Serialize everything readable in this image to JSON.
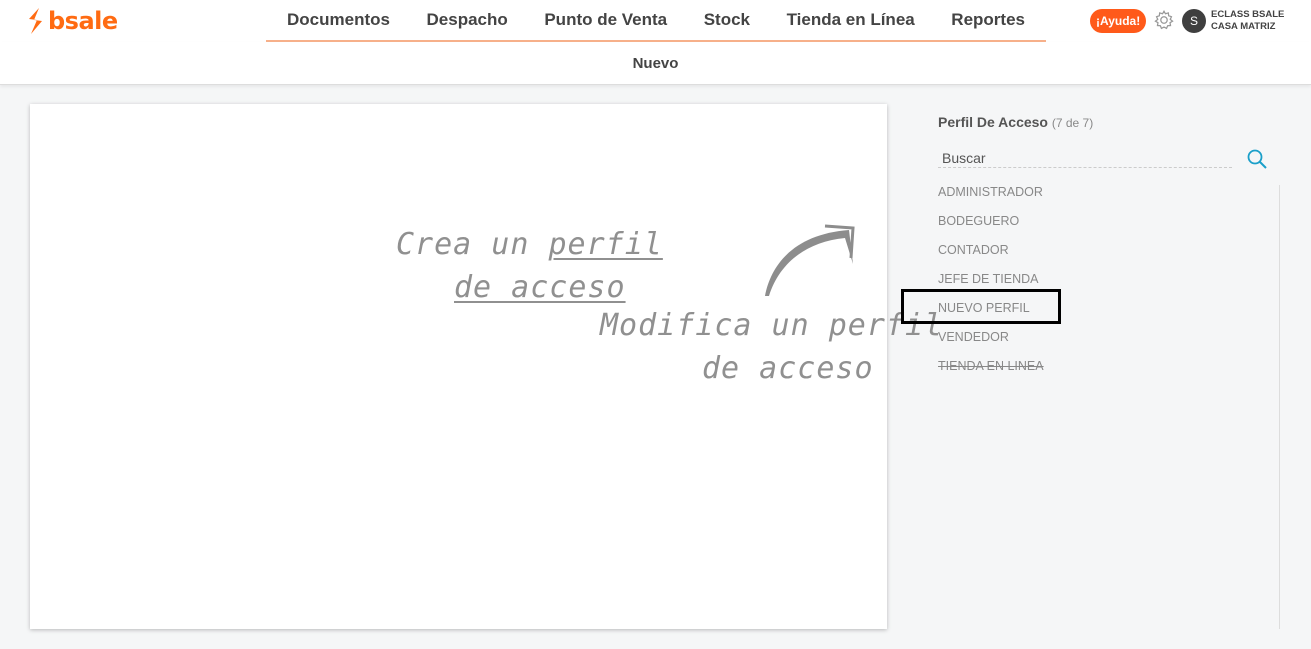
{
  "brand": {
    "name": "bsale",
    "color": "#ff6b12"
  },
  "nav": {
    "items": [
      "Documentos",
      "Despacho",
      "Punto de Venta",
      "Stock",
      "Tienda en Línea",
      "Reportes"
    ]
  },
  "header": {
    "help_label": "¡Ayuda!",
    "avatar_initial": "S",
    "company_line1": "ECLASS BSALE",
    "company_line2": "CASA MATRIZ"
  },
  "subbar": {
    "new_label": "Nuevo"
  },
  "card": {
    "create_text_1": "Crea un ",
    "create_link_1": "perfil",
    "create_link_2": "de acceso",
    "modify_text_1": "Modifica un perfil",
    "modify_text_2": "de acceso"
  },
  "panel": {
    "title": "Perfil De Acceso",
    "count": "(7 de 7)",
    "search_placeholder": "Buscar",
    "profiles": [
      {
        "label": "ADMINISTRADOR",
        "disabled": false
      },
      {
        "label": "BODEGUERO",
        "disabled": false
      },
      {
        "label": "CONTADOR",
        "disabled": false
      },
      {
        "label": "JEFE DE TIENDA",
        "disabled": false
      },
      {
        "label": "NUEVO PERFIL",
        "disabled": false
      },
      {
        "label": "VENDEDOR",
        "disabled": false
      },
      {
        "label": "TIENDA EN LINEA",
        "disabled": true
      }
    ]
  },
  "colors": {
    "accent": "#ff6b12",
    "help_button": "#ff5a1a",
    "search_icon": "#1a9fc9"
  }
}
